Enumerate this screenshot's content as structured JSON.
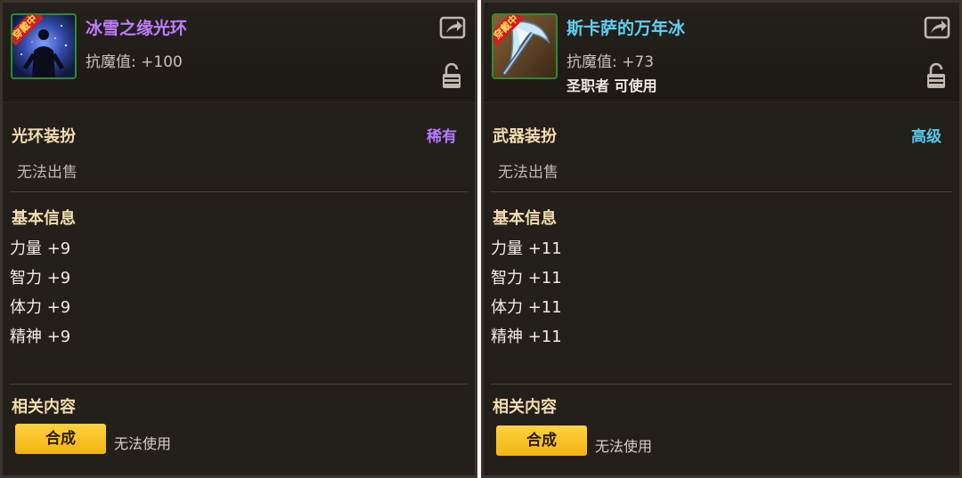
{
  "panels": [
    {
      "icon": "aura-figure-icon",
      "wear_tag": "穿戴中",
      "name": "冰雪之缘光环",
      "name_color": "#c07cff",
      "stat": "抗魔值: +100",
      "class_restriction": "",
      "category": "光环装扮",
      "rarity": "稀有",
      "rarity_color": "#b57aff",
      "sell": "无法出售",
      "basic_title": "基本信息",
      "stats": [
        "力量 +9",
        "智力 +9",
        "体力 +9",
        "精神 +9"
      ],
      "related_title": "相关内容",
      "synth_label": "合成",
      "use_status": "无法使用"
    },
    {
      "icon": "ice-scythe-icon",
      "wear_tag": "穿戴中",
      "name": "斯卡萨的万年冰",
      "name_color": "#5fd0f0",
      "stat": "抗魔值: +73",
      "class_restriction": "圣职者 可使用",
      "category": "武器装扮",
      "rarity": "高级",
      "rarity_color": "#56c7ea",
      "sell": "无法出售",
      "basic_title": "基本信息",
      "stats": [
        "力量 +11",
        "智力 +11",
        "体力 +11",
        "精神 +11"
      ],
      "related_title": "相关内容",
      "synth_label": "合成",
      "use_status": "无法使用"
    }
  ]
}
